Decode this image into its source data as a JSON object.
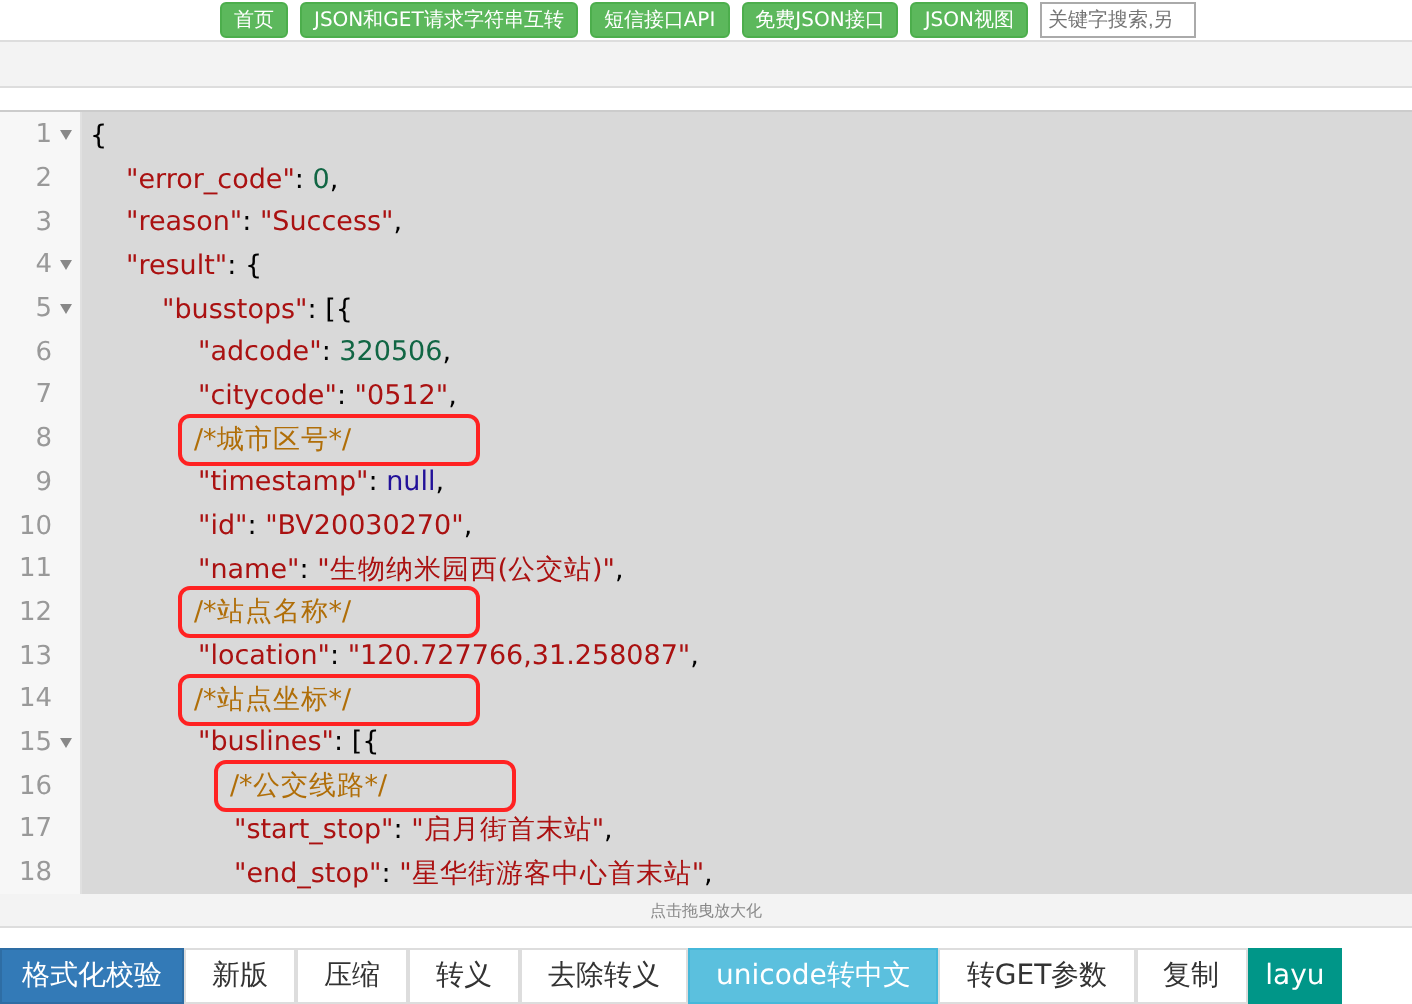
{
  "top_nav": {
    "buttons": [
      "首页",
      "JSON和GET请求字符串互转",
      "短信接口API",
      "免费JSON接口",
      "JSON视图"
    ],
    "search": {
      "placeholder": "关键字搜索,另"
    }
  },
  "editor": {
    "lines": [
      {
        "number": "1",
        "fold": true,
        "tokens": [
          {
            "kind": "punct",
            "text": "{"
          }
        ]
      },
      {
        "number": "2",
        "fold": false,
        "tokens": [
          {
            "kind": "key",
            "text": "\"error_code\""
          },
          {
            "kind": "punct",
            "text": ": "
          },
          {
            "kind": "number",
            "text": "0"
          },
          {
            "kind": "punct",
            "text": ","
          }
        ]
      },
      {
        "number": "3",
        "fold": false,
        "tokens": [
          {
            "kind": "key",
            "text": "\"reason\""
          },
          {
            "kind": "punct",
            "text": ": "
          },
          {
            "kind": "string",
            "text": "\"Success\""
          },
          {
            "kind": "punct",
            "text": ","
          }
        ]
      },
      {
        "number": "4",
        "fold": true,
        "tokens": [
          {
            "kind": "key",
            "text": "\"result\""
          },
          {
            "kind": "punct",
            "text": ": {"
          }
        ]
      },
      {
        "number": "5",
        "fold": true,
        "tokens": [
          {
            "kind": "key",
            "text": "\"busstops\""
          },
          {
            "kind": "punct",
            "text": ": [{"
          }
        ]
      },
      {
        "number": "6",
        "fold": false,
        "tokens": [
          {
            "kind": "key",
            "text": "\"adcode\""
          },
          {
            "kind": "punct",
            "text": ": "
          },
          {
            "kind": "number",
            "text": "320506"
          },
          {
            "kind": "punct",
            "text": ","
          }
        ]
      },
      {
        "number": "7",
        "fold": false,
        "tokens": [
          {
            "kind": "key",
            "text": "\"citycode\""
          },
          {
            "kind": "punct",
            "text": ": "
          },
          {
            "kind": "string",
            "text": "\"0512\""
          },
          {
            "kind": "punct",
            "text": ","
          }
        ]
      },
      {
        "number": "8",
        "fold": false,
        "tokens": [
          {
            "kind": "comment",
            "text": "/*城市区号*/",
            "annotated": true
          }
        ]
      },
      {
        "number": "9",
        "fold": false,
        "tokens": [
          {
            "kind": "key",
            "text": "\"timestamp\""
          },
          {
            "kind": "punct",
            "text": ": "
          },
          {
            "kind": "null",
            "text": "null"
          },
          {
            "kind": "punct",
            "text": ","
          }
        ]
      },
      {
        "number": "10",
        "fold": false,
        "tokens": [
          {
            "kind": "key",
            "text": "\"id\""
          },
          {
            "kind": "punct",
            "text": ": "
          },
          {
            "kind": "string",
            "text": "\"BV20030270\""
          },
          {
            "kind": "punct",
            "text": ","
          }
        ]
      },
      {
        "number": "11",
        "fold": false,
        "tokens": [
          {
            "kind": "key",
            "text": "\"name\""
          },
          {
            "kind": "punct",
            "text": ": "
          },
          {
            "kind": "string",
            "text": "\"生物纳米园西(公交站)\""
          },
          {
            "kind": "punct",
            "text": ","
          }
        ]
      },
      {
        "number": "12",
        "fold": false,
        "tokens": [
          {
            "kind": "comment",
            "text": "/*站点名称*/",
            "annotated": true
          }
        ]
      },
      {
        "number": "13",
        "fold": false,
        "tokens": [
          {
            "kind": "key",
            "text": "\"location\""
          },
          {
            "kind": "punct",
            "text": ": "
          },
          {
            "kind": "string",
            "text": "\"120.727766,31.258087\""
          },
          {
            "kind": "punct",
            "text": ","
          }
        ]
      },
      {
        "number": "14",
        "fold": false,
        "tokens": [
          {
            "kind": "comment",
            "text": "/*站点坐标*/",
            "annotated": true
          }
        ]
      },
      {
        "number": "15",
        "fold": true,
        "tokens": [
          {
            "kind": "key",
            "text": "\"buslines\""
          },
          {
            "kind": "punct",
            "text": ": [{"
          }
        ]
      },
      {
        "number": "16",
        "fold": false,
        "tokens": [
          {
            "kind": "comment",
            "text": "/*公交线路*/",
            "annotated": true
          }
        ]
      },
      {
        "number": "17",
        "fold": false,
        "tokens": [
          {
            "kind": "key",
            "text": "\"start_stop\""
          },
          {
            "kind": "punct",
            "text": ": "
          },
          {
            "kind": "string",
            "text": "\"启月街首末站\""
          },
          {
            "kind": "punct",
            "text": ","
          }
        ]
      },
      {
        "number": "18",
        "fold": false,
        "tokens": [
          {
            "kind": "key",
            "text": "\"end_stop\""
          },
          {
            "kind": "punct",
            "text": ": "
          },
          {
            "kind": "string",
            "text": "\"星华街游客中心首末站\""
          },
          {
            "kind": "punct",
            "text": ","
          }
        ]
      }
    ],
    "resize_hint": "点击拖曳放大化"
  },
  "toolbar": [
    {
      "label": "格式化校验",
      "kind": "primary"
    },
    {
      "label": "新版",
      "kind": "default"
    },
    {
      "label": "压缩",
      "kind": "default"
    },
    {
      "label": "转义",
      "kind": "default"
    },
    {
      "label": "去除转义",
      "kind": "default"
    },
    {
      "label": "unicode转中文",
      "kind": "info"
    },
    {
      "label": "转GET参数",
      "kind": "default"
    },
    {
      "label": "复制",
      "kind": "default"
    },
    {
      "label": "layu",
      "kind": "teal"
    }
  ]
}
